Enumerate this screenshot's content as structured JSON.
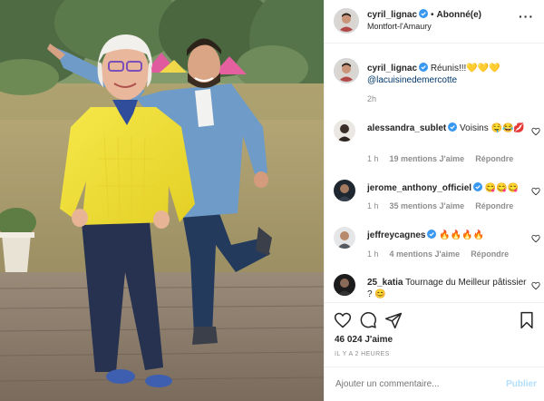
{
  "post": {
    "author": "cyril_lignac",
    "follow_status": "Abonné(e)",
    "location": "Montfort-l'Amaury",
    "more_icon": "more-horizontal-icon"
  },
  "caption": {
    "author": "cyril_lignac",
    "text": "Réunis!!!💛💛💛",
    "mention": "@lacuisinedemercotte",
    "time": "2h"
  },
  "comments": [
    {
      "user": "alessandra_sublet",
      "verified": true,
      "text": "Voisins 🤤😂💋",
      "time": "1 h",
      "likes": "19 mentions J'aime",
      "reply": "Répondre"
    },
    {
      "user": "jerome_anthony_officiel",
      "verified": true,
      "text": "😋😋😋",
      "time": "1 h",
      "likes": "35 mentions J'aime",
      "reply": "Répondre"
    },
    {
      "user": "jeffreycagnes",
      "verified": true,
      "text": "🔥🔥🔥🔥",
      "time": "1 h",
      "likes": "4 mentions J'aime",
      "reply": "Répondre"
    },
    {
      "user": "25_katia",
      "verified": false,
      "text": "Tournage du Meilleur pâtissier ? 😊",
      "time": "",
      "likes": "",
      "reply": ""
    }
  ],
  "actions": {
    "likes_count": "46 024",
    "likes_label": "J'aime",
    "post_time": "IL Y A 2 HEURES",
    "comment_placeholder": "Ajouter un commentaire...",
    "publish_label": "Publier"
  },
  "colors": {
    "verified": "#3897f0",
    "link": "#00376b",
    "muted": "#8e8e8e",
    "publish_disabled": "#b2dffc"
  }
}
